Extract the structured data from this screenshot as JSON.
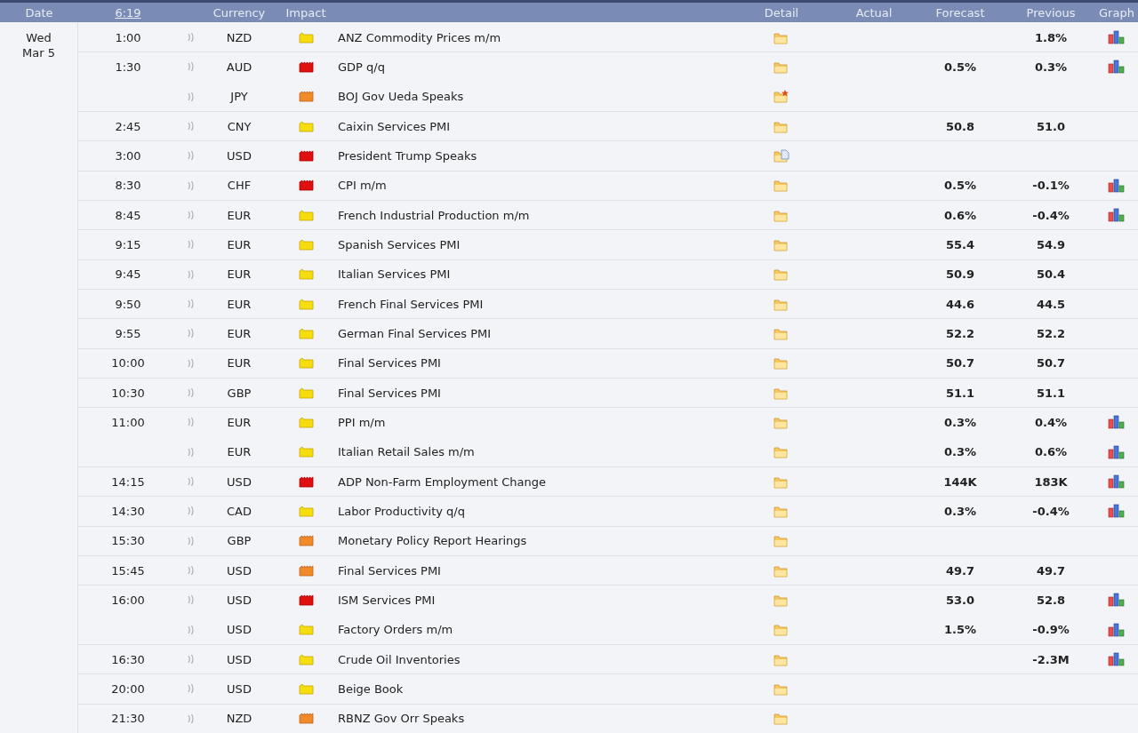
{
  "header": {
    "date": "Date",
    "time": "6:19",
    "currency": "Currency",
    "impact": "Impact",
    "detail": "Detail",
    "actual": "Actual",
    "forecast": "Forecast",
    "previous": "Previous",
    "graph": "Graph"
  },
  "day": {
    "weekday": "Wed",
    "date": "Mar 5"
  },
  "rows": [
    {
      "time": "1:00",
      "currency": "NZD",
      "impact": {
        "kind": "low"
      },
      "event": "ANZ Commodity Prices m/m",
      "detail": {
        "kind": "folder"
      },
      "forecast": "",
      "previous": "1.8%",
      "graph": true
    },
    {
      "time": "1:30",
      "currency": "AUD",
      "impact": {
        "kind": "high"
      },
      "event": "GDP q/q",
      "detail": {
        "kind": "folder"
      },
      "forecast": "0.5%",
      "previous": "0.3%",
      "graph": true
    },
    {
      "time": "",
      "currency": "JPY",
      "impact": {
        "kind": "medium"
      },
      "event": "BOJ Gov Ueda Speaks",
      "detail": {
        "kind": "folder-star"
      },
      "forecast": "",
      "previous": "",
      "graph": false
    },
    {
      "time": "2:45",
      "currency": "CNY",
      "impact": {
        "kind": "low"
      },
      "event": "Caixin Services PMI",
      "detail": {
        "kind": "folder"
      },
      "forecast": "50.8",
      "previous": "51.0",
      "graph": false
    },
    {
      "time": "3:00",
      "currency": "USD",
      "impact": {
        "kind": "high"
      },
      "event": "President Trump Speaks",
      "detail": {
        "kind": "folder-doc"
      },
      "forecast": "",
      "previous": "",
      "graph": false
    },
    {
      "time": "8:30",
      "currency": "CHF",
      "impact": {
        "kind": "high"
      },
      "event": "CPI m/m",
      "detail": {
        "kind": "folder"
      },
      "forecast": "0.5%",
      "previous": "-0.1%",
      "graph": true
    },
    {
      "time": "8:45",
      "currency": "EUR",
      "impact": {
        "kind": "low"
      },
      "event": "French Industrial Production m/m",
      "detail": {
        "kind": "folder"
      },
      "forecast": "0.6%",
      "previous": "-0.4%",
      "graph": true
    },
    {
      "time": "9:15",
      "currency": "EUR",
      "impact": {
        "kind": "low"
      },
      "event": "Spanish Services PMI",
      "detail": {
        "kind": "folder"
      },
      "forecast": "55.4",
      "previous": "54.9",
      "graph": false
    },
    {
      "time": "9:45",
      "currency": "EUR",
      "impact": {
        "kind": "low"
      },
      "event": "Italian Services PMI",
      "detail": {
        "kind": "folder"
      },
      "forecast": "50.9",
      "previous": "50.4",
      "graph": false
    },
    {
      "time": "9:50",
      "currency": "EUR",
      "impact": {
        "kind": "low"
      },
      "event": "French Final Services PMI",
      "detail": {
        "kind": "folder"
      },
      "forecast": "44.6",
      "previous": "44.5",
      "graph": false
    },
    {
      "time": "9:55",
      "currency": "EUR",
      "impact": {
        "kind": "low"
      },
      "event": "German Final Services PMI",
      "detail": {
        "kind": "folder"
      },
      "forecast": "52.2",
      "previous": "52.2",
      "graph": false
    },
    {
      "time": "10:00",
      "currency": "EUR",
      "impact": {
        "kind": "low"
      },
      "event": "Final Services PMI",
      "detail": {
        "kind": "folder"
      },
      "forecast": "50.7",
      "previous": "50.7",
      "graph": false
    },
    {
      "time": "10:30",
      "currency": "GBP",
      "impact": {
        "kind": "low"
      },
      "event": "Final Services PMI",
      "detail": {
        "kind": "folder"
      },
      "forecast": "51.1",
      "previous": "51.1",
      "graph": false
    },
    {
      "time": "11:00",
      "currency": "EUR",
      "impact": {
        "kind": "low"
      },
      "event": "PPI m/m",
      "detail": {
        "kind": "folder"
      },
      "forecast": "0.3%",
      "previous": "0.4%",
      "graph": true
    },
    {
      "time": "",
      "currency": "EUR",
      "impact": {
        "kind": "low"
      },
      "event": "Italian Retail Sales m/m",
      "detail": {
        "kind": "folder"
      },
      "forecast": "0.3%",
      "previous": "0.6%",
      "graph": true
    },
    {
      "time": "14:15",
      "currency": "USD",
      "impact": {
        "kind": "high"
      },
      "event": "ADP Non-Farm Employment Change",
      "detail": {
        "kind": "folder"
      },
      "forecast": "144K",
      "previous": "183K",
      "graph": true
    },
    {
      "time": "14:30",
      "currency": "CAD",
      "impact": {
        "kind": "low"
      },
      "event": "Labor Productivity q/q",
      "detail": {
        "kind": "folder"
      },
      "forecast": "0.3%",
      "previous": "-0.4%",
      "graph": true
    },
    {
      "time": "15:30",
      "currency": "GBP",
      "impact": {
        "kind": "medium"
      },
      "event": "Monetary Policy Report Hearings",
      "detail": {
        "kind": "folder"
      },
      "forecast": "",
      "previous": "",
      "graph": false
    },
    {
      "time": "15:45",
      "currency": "USD",
      "impact": {
        "kind": "medium"
      },
      "event": "Final Services PMI",
      "detail": {
        "kind": "folder"
      },
      "forecast": "49.7",
      "previous": "49.7",
      "graph": false
    },
    {
      "time": "16:00",
      "currency": "USD",
      "impact": {
        "kind": "high"
      },
      "event": "ISM Services PMI",
      "detail": {
        "kind": "folder"
      },
      "forecast": "53.0",
      "previous": "52.8",
      "graph": true
    },
    {
      "time": "",
      "currency": "USD",
      "impact": {
        "kind": "low"
      },
      "event": "Factory Orders m/m",
      "detail": {
        "kind": "folder"
      },
      "forecast": "1.5%",
      "previous": "-0.9%",
      "graph": true
    },
    {
      "time": "16:30",
      "currency": "USD",
      "impact": {
        "kind": "low"
      },
      "event": "Crude Oil Inventories",
      "detail": {
        "kind": "folder"
      },
      "forecast": "",
      "previous": "-2.3M",
      "graph": true
    },
    {
      "time": "20:00",
      "currency": "USD",
      "impact": {
        "kind": "low"
      },
      "event": "Beige Book",
      "detail": {
        "kind": "folder"
      },
      "forecast": "",
      "previous": "",
      "graph": false
    },
    {
      "time": "21:30",
      "currency": "NZD",
      "impact": {
        "kind": "medium"
      },
      "event": "RBNZ Gov Orr Speaks",
      "detail": {
        "kind": "folder"
      },
      "forecast": "",
      "previous": "",
      "graph": false
    }
  ]
}
